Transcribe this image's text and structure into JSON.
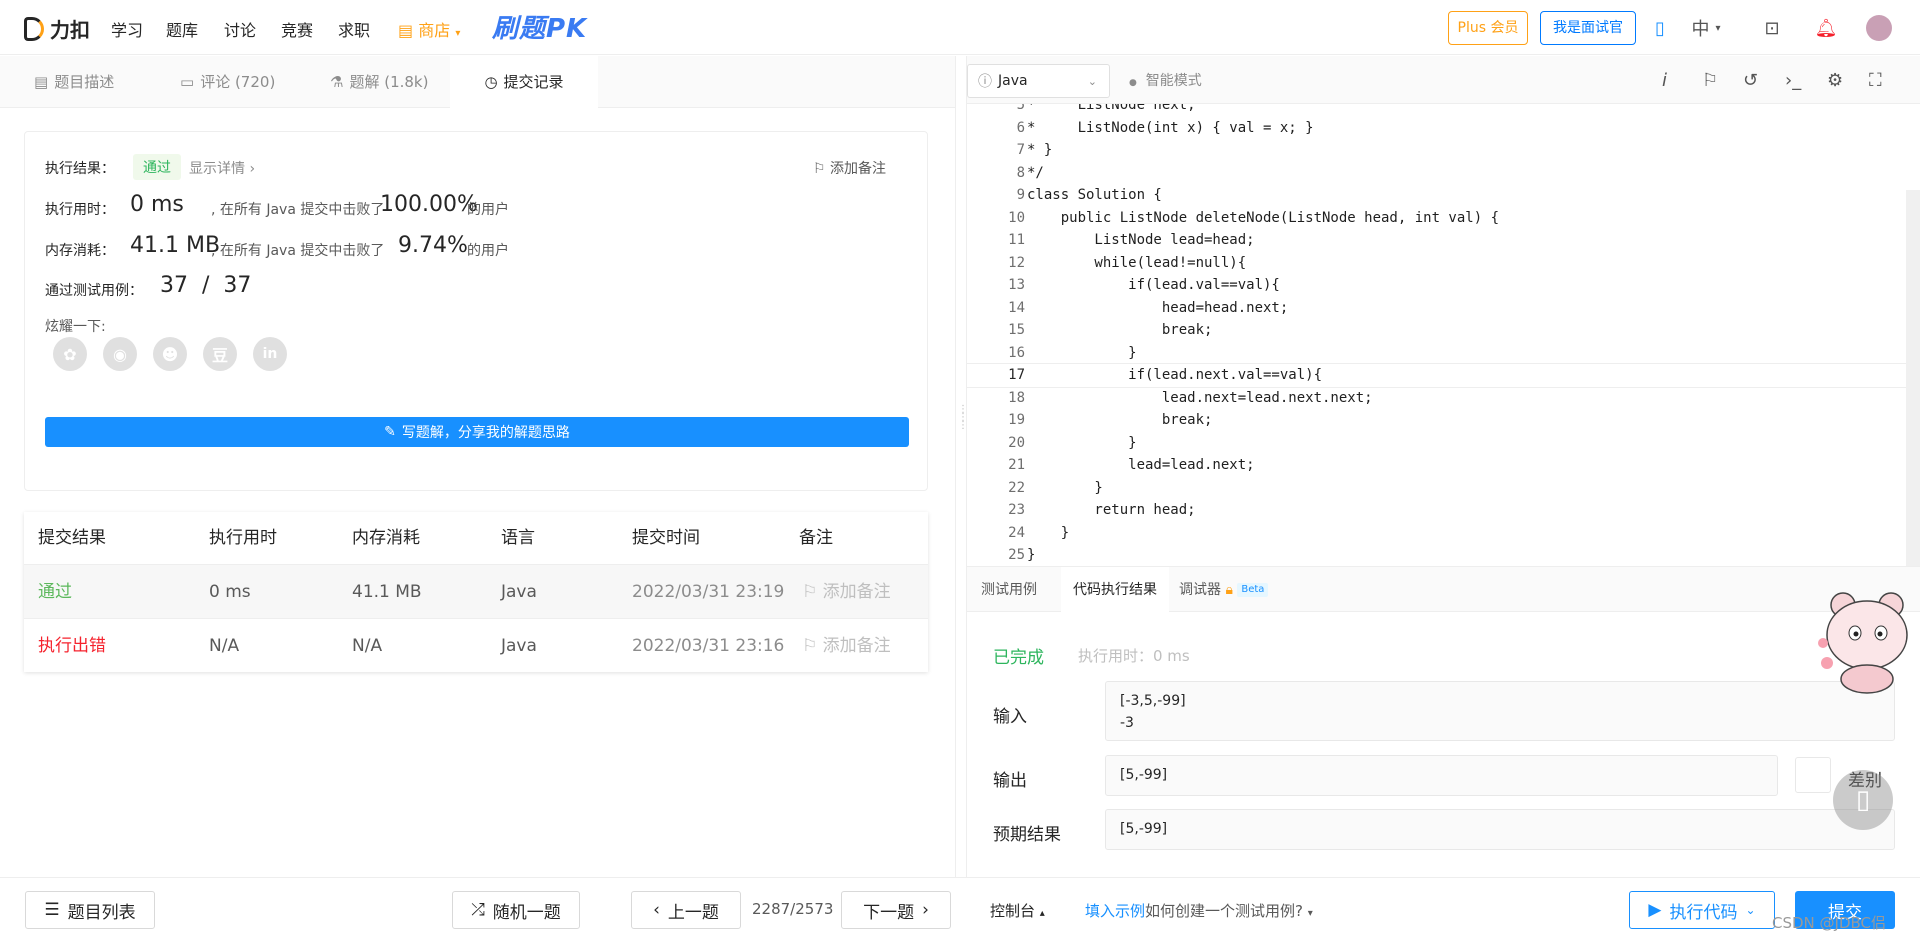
{
  "nav": {
    "brand": "力扣",
    "items": [
      "学习",
      "题库",
      "讨论",
      "竞赛",
      "求职"
    ],
    "shop": "商店",
    "pk": "刷题PK",
    "plus_label": "Plus 会员",
    "interviewer_label": "我是面试官",
    "lang_label": "中"
  },
  "left_tabs": [
    {
      "label": "题目描述",
      "icon": "description-icon"
    },
    {
      "label": "评论 (720)",
      "icon": "comment-icon"
    },
    {
      "label": "题解 (1.8k)",
      "icon": "flask-icon"
    },
    {
      "label": "提交记录",
      "icon": "clock-icon"
    }
  ],
  "result": {
    "exec_result_label": "执行结果：",
    "status": "通过",
    "details_link": "显示详情 ›",
    "add_note": "添加备注",
    "time_label": "执行用时：",
    "time_value": "0 ms",
    "time_desc": ", 在所有 Java 提交中击败了",
    "time_pct": "100.00%",
    "users_suffix": "的用户",
    "mem_label": "内存消耗：",
    "mem_value": "41.1 MB",
    "mem_desc": ", 在所有 Java 提交中击败了",
    "mem_pct": "9.74%",
    "cases_label": "通过测试用例：",
    "cases_value": "37  /  37",
    "share_label": "炫耀一下:",
    "write_solution": "写题解，分享我的解题思路"
  },
  "submissions": {
    "headers": [
      "提交结果",
      "执行用时",
      "内存消耗",
      "语言",
      "提交时间",
      "备注"
    ],
    "rows": [
      {
        "status": "通过",
        "time": "0 ms",
        "memory": "41.1 MB",
        "lang": "Java",
        "submitted": "2022/03/31 23:19",
        "note": "添加备注",
        "status_color": "#5cb85c"
      },
      {
        "status": "执行出错",
        "time": "N/A",
        "memory": "N/A",
        "lang": "Java",
        "submitted": "2022/03/31 23:16",
        "note": "添加备注",
        "status_color": "#f5222d"
      }
    ]
  },
  "bottom": {
    "problem_list": "题目列表",
    "random": "随机一题",
    "prev": "上一题",
    "page": "2287/2573",
    "next": "下一题",
    "console": "控制台",
    "fill_example": "填入示例",
    "how_create": "如何创建一个测试用例?",
    "run": "执行代码",
    "submit": "提交"
  },
  "editor": {
    "language": "Java",
    "smart_mode": "智能模式",
    "lines": [
      {
        "n": "5",
        "text": "*     ListNode next;"
      },
      {
        "n": "6",
        "text": "*     ListNode(int x) { val = x; }"
      },
      {
        "n": "7",
        "text": "* }"
      },
      {
        "n": "8",
        "text": "*/"
      },
      {
        "n": "9",
        "text": "class Solution {"
      },
      {
        "n": "10",
        "text": "    public ListNode deleteNode(ListNode head, int val) {"
      },
      {
        "n": "11",
        "text": "        ListNode lead=head;"
      },
      {
        "n": "12",
        "text": "        while(lead!=null){"
      },
      {
        "n": "13",
        "text": "            if(lead.val==val){"
      },
      {
        "n": "14",
        "text": "                head=head.next;"
      },
      {
        "n": "15",
        "text": "                break;"
      },
      {
        "n": "16",
        "text": "            }"
      },
      {
        "n": "17",
        "text": "            if(lead.next.val==val){"
      },
      {
        "n": "18",
        "text": "                lead.next=lead.next.next;"
      },
      {
        "n": "19",
        "text": "                break;"
      },
      {
        "n": "20",
        "text": "            }"
      },
      {
        "n": "21",
        "text": "            lead=lead.next;"
      },
      {
        "n": "22",
        "text": "        }"
      },
      {
        "n": "23",
        "text": "        return head;"
      },
      {
        "n": "24",
        "text": "    }"
      },
      {
        "n": "25",
        "text": "}"
      }
    ]
  },
  "run_panel": {
    "tabs": [
      "测试用例",
      "代码执行结果",
      "调试器"
    ],
    "beta": "Beta",
    "status": "已完成",
    "exec_time": "执行用时：0 ms",
    "input_label": "输入",
    "input_value_1": "[-3,5,-99]",
    "input_value_2": "-3",
    "output_label": "输出",
    "output_value": "[5,-99]",
    "diff_label": "差别",
    "expected_label": "预期结果",
    "expected_value": "[5,-99]"
  },
  "watermark": "CSDN @JDBC侣"
}
